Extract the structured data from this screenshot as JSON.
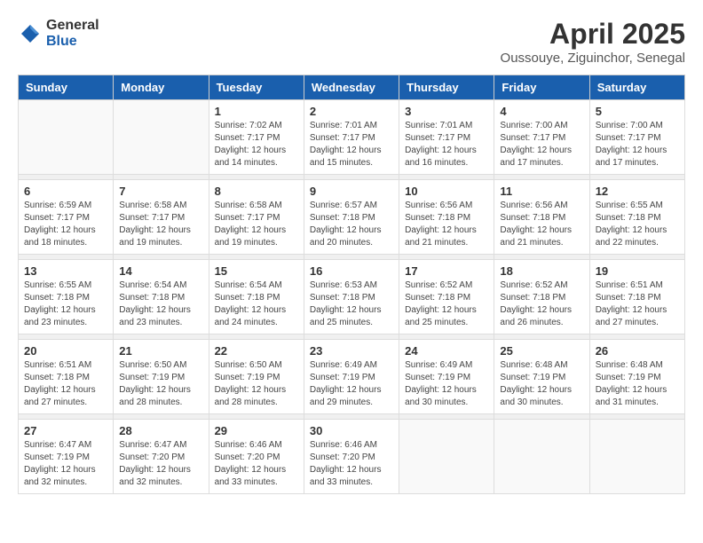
{
  "logo": {
    "general": "General",
    "blue": "Blue"
  },
  "title": "April 2025",
  "subtitle": "Oussouye, Ziguinchor, Senegal",
  "days_of_week": [
    "Sunday",
    "Monday",
    "Tuesday",
    "Wednesday",
    "Thursday",
    "Friday",
    "Saturday"
  ],
  "weeks": [
    [
      {
        "day": "",
        "sunrise": "",
        "sunset": "",
        "daylight": "",
        "empty": true
      },
      {
        "day": "",
        "sunrise": "",
        "sunset": "",
        "daylight": "",
        "empty": true
      },
      {
        "day": "1",
        "sunrise": "Sunrise: 7:02 AM",
        "sunset": "Sunset: 7:17 PM",
        "daylight": "Daylight: 12 hours and 14 minutes.",
        "empty": false
      },
      {
        "day": "2",
        "sunrise": "Sunrise: 7:01 AM",
        "sunset": "Sunset: 7:17 PM",
        "daylight": "Daylight: 12 hours and 15 minutes.",
        "empty": false
      },
      {
        "day": "3",
        "sunrise": "Sunrise: 7:01 AM",
        "sunset": "Sunset: 7:17 PM",
        "daylight": "Daylight: 12 hours and 16 minutes.",
        "empty": false
      },
      {
        "day": "4",
        "sunrise": "Sunrise: 7:00 AM",
        "sunset": "Sunset: 7:17 PM",
        "daylight": "Daylight: 12 hours and 17 minutes.",
        "empty": false
      },
      {
        "day": "5",
        "sunrise": "Sunrise: 7:00 AM",
        "sunset": "Sunset: 7:17 PM",
        "daylight": "Daylight: 12 hours and 17 minutes.",
        "empty": false
      }
    ],
    [
      {
        "day": "6",
        "sunrise": "Sunrise: 6:59 AM",
        "sunset": "Sunset: 7:17 PM",
        "daylight": "Daylight: 12 hours and 18 minutes.",
        "empty": false
      },
      {
        "day": "7",
        "sunrise": "Sunrise: 6:58 AM",
        "sunset": "Sunset: 7:17 PM",
        "daylight": "Daylight: 12 hours and 19 minutes.",
        "empty": false
      },
      {
        "day": "8",
        "sunrise": "Sunrise: 6:58 AM",
        "sunset": "Sunset: 7:17 PM",
        "daylight": "Daylight: 12 hours and 19 minutes.",
        "empty": false
      },
      {
        "day": "9",
        "sunrise": "Sunrise: 6:57 AM",
        "sunset": "Sunset: 7:18 PM",
        "daylight": "Daylight: 12 hours and 20 minutes.",
        "empty": false
      },
      {
        "day": "10",
        "sunrise": "Sunrise: 6:56 AM",
        "sunset": "Sunset: 7:18 PM",
        "daylight": "Daylight: 12 hours and 21 minutes.",
        "empty": false
      },
      {
        "day": "11",
        "sunrise": "Sunrise: 6:56 AM",
        "sunset": "Sunset: 7:18 PM",
        "daylight": "Daylight: 12 hours and 21 minutes.",
        "empty": false
      },
      {
        "day": "12",
        "sunrise": "Sunrise: 6:55 AM",
        "sunset": "Sunset: 7:18 PM",
        "daylight": "Daylight: 12 hours and 22 minutes.",
        "empty": false
      }
    ],
    [
      {
        "day": "13",
        "sunrise": "Sunrise: 6:55 AM",
        "sunset": "Sunset: 7:18 PM",
        "daylight": "Daylight: 12 hours and 23 minutes.",
        "empty": false
      },
      {
        "day": "14",
        "sunrise": "Sunrise: 6:54 AM",
        "sunset": "Sunset: 7:18 PM",
        "daylight": "Daylight: 12 hours and 23 minutes.",
        "empty": false
      },
      {
        "day": "15",
        "sunrise": "Sunrise: 6:54 AM",
        "sunset": "Sunset: 7:18 PM",
        "daylight": "Daylight: 12 hours and 24 minutes.",
        "empty": false
      },
      {
        "day": "16",
        "sunrise": "Sunrise: 6:53 AM",
        "sunset": "Sunset: 7:18 PM",
        "daylight": "Daylight: 12 hours and 25 minutes.",
        "empty": false
      },
      {
        "day": "17",
        "sunrise": "Sunrise: 6:52 AM",
        "sunset": "Sunset: 7:18 PM",
        "daylight": "Daylight: 12 hours and 25 minutes.",
        "empty": false
      },
      {
        "day": "18",
        "sunrise": "Sunrise: 6:52 AM",
        "sunset": "Sunset: 7:18 PM",
        "daylight": "Daylight: 12 hours and 26 minutes.",
        "empty": false
      },
      {
        "day": "19",
        "sunrise": "Sunrise: 6:51 AM",
        "sunset": "Sunset: 7:18 PM",
        "daylight": "Daylight: 12 hours and 27 minutes.",
        "empty": false
      }
    ],
    [
      {
        "day": "20",
        "sunrise": "Sunrise: 6:51 AM",
        "sunset": "Sunset: 7:18 PM",
        "daylight": "Daylight: 12 hours and 27 minutes.",
        "empty": false
      },
      {
        "day": "21",
        "sunrise": "Sunrise: 6:50 AM",
        "sunset": "Sunset: 7:19 PM",
        "daylight": "Daylight: 12 hours and 28 minutes.",
        "empty": false
      },
      {
        "day": "22",
        "sunrise": "Sunrise: 6:50 AM",
        "sunset": "Sunset: 7:19 PM",
        "daylight": "Daylight: 12 hours and 28 minutes.",
        "empty": false
      },
      {
        "day": "23",
        "sunrise": "Sunrise: 6:49 AM",
        "sunset": "Sunset: 7:19 PM",
        "daylight": "Daylight: 12 hours and 29 minutes.",
        "empty": false
      },
      {
        "day": "24",
        "sunrise": "Sunrise: 6:49 AM",
        "sunset": "Sunset: 7:19 PM",
        "daylight": "Daylight: 12 hours and 30 minutes.",
        "empty": false
      },
      {
        "day": "25",
        "sunrise": "Sunrise: 6:48 AM",
        "sunset": "Sunset: 7:19 PM",
        "daylight": "Daylight: 12 hours and 30 minutes.",
        "empty": false
      },
      {
        "day": "26",
        "sunrise": "Sunrise: 6:48 AM",
        "sunset": "Sunset: 7:19 PM",
        "daylight": "Daylight: 12 hours and 31 minutes.",
        "empty": false
      }
    ],
    [
      {
        "day": "27",
        "sunrise": "Sunrise: 6:47 AM",
        "sunset": "Sunset: 7:19 PM",
        "daylight": "Daylight: 12 hours and 32 minutes.",
        "empty": false
      },
      {
        "day": "28",
        "sunrise": "Sunrise: 6:47 AM",
        "sunset": "Sunset: 7:20 PM",
        "daylight": "Daylight: 12 hours and 32 minutes.",
        "empty": false
      },
      {
        "day": "29",
        "sunrise": "Sunrise: 6:46 AM",
        "sunset": "Sunset: 7:20 PM",
        "daylight": "Daylight: 12 hours and 33 minutes.",
        "empty": false
      },
      {
        "day": "30",
        "sunrise": "Sunrise: 6:46 AM",
        "sunset": "Sunset: 7:20 PM",
        "daylight": "Daylight: 12 hours and 33 minutes.",
        "empty": false
      },
      {
        "day": "",
        "sunrise": "",
        "sunset": "",
        "daylight": "",
        "empty": true
      },
      {
        "day": "",
        "sunrise": "",
        "sunset": "",
        "daylight": "",
        "empty": true
      },
      {
        "day": "",
        "sunrise": "",
        "sunset": "",
        "daylight": "",
        "empty": true
      }
    ]
  ]
}
